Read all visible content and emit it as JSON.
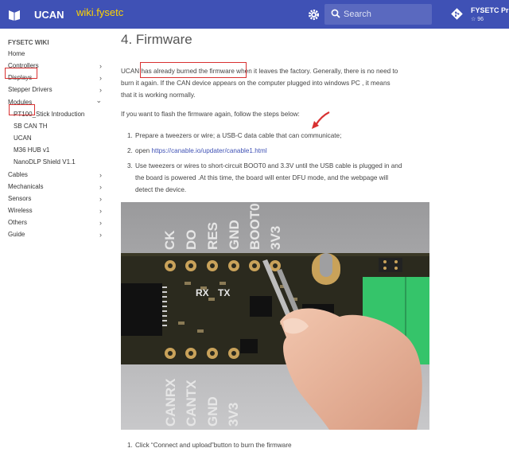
{
  "header": {
    "site_name": "UCAN",
    "annotation": "wiki.fysetc",
    "search_placeholder": "Search",
    "repo_name": "FYSETC Products",
    "repo_stars": "96",
    "bar_color": "#3f51b5"
  },
  "sidebar": {
    "title": "FYSETC WIKI",
    "items": [
      {
        "label": "Home",
        "chevron": ""
      },
      {
        "label": "Controllers",
        "chevron": "›"
      },
      {
        "label": "Displays",
        "chevron": "›"
      },
      {
        "label": "Stepper Drivers",
        "chevron": "›"
      },
      {
        "label": "Modules",
        "chevron": "⌄"
      },
      {
        "label": "PT100_Stick Introduction",
        "chevron": ""
      },
      {
        "label": "SB CAN TH",
        "chevron": ""
      },
      {
        "label": "UCAN",
        "chevron": ""
      },
      {
        "label": "M36 HUB v1",
        "chevron": ""
      },
      {
        "label": "NanoDLP Shield V1.1",
        "chevron": ""
      },
      {
        "label": "Cables",
        "chevron": "›"
      },
      {
        "label": "Mechanicals",
        "chevron": "›"
      },
      {
        "label": "Sensors",
        "chevron": "›"
      },
      {
        "label": "Wireless",
        "chevron": "›"
      },
      {
        "label": "Others",
        "chevron": "›"
      },
      {
        "label": "Guide",
        "chevron": "›"
      }
    ]
  },
  "main": {
    "heading": "4. Firmware",
    "intro_line1_a": "UCAN ",
    "intro_line1_b": "has already burned the firmware",
    "intro_line1_c": " when it leaves the factory. Generally, there is no need to",
    "intro_line2": "burn it again. If the CAN device appears on the computer plugged into windows PC , it means",
    "intro_line3": "that it is working normally.",
    "flash_intro": "If you want to flash the firmware again, follow the steps below:",
    "steps": [
      {
        "num": "1.",
        "text": "Prepare a tweezers or wire; a USB-C data cable that can communicate;"
      },
      {
        "num": "2.",
        "text_prefix": "open ",
        "link": "https://canable.io/updater/canable1.html"
      },
      {
        "num": "3.",
        "line1": "Use tweezers or wires to short-circuit BOOT0 and 3.3V until the USB cable is plugged in and",
        "line2": "the board is powered .At this time, the board will enter DFU mode, and the webpage will",
        "line3": "detect the device."
      }
    ],
    "board_top_labels": [
      "CK",
      "DO",
      "RES",
      "GND",
      "BOOT0",
      "3V3"
    ],
    "board_bottom_labels": [
      "CANRX",
      "CANTX",
      "GND",
      "3V3"
    ],
    "board_mid_labels": [
      "RX",
      "TX"
    ],
    "final_step_num": "1.",
    "final_step": "Click “Connect and upload”button to burn the firmware",
    "highlight_color": "#d83131"
  }
}
